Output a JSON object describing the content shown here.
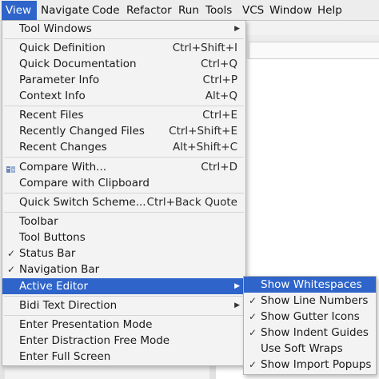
{
  "menubar": {
    "items": [
      {
        "label": "View",
        "active": true
      },
      {
        "label": "Navigate"
      },
      {
        "label": "Code"
      },
      {
        "label": "Refactor"
      },
      {
        "label": "Run"
      },
      {
        "label": "Tools"
      },
      {
        "label": "VCS"
      },
      {
        "label": "Window"
      },
      {
        "label": "Help"
      }
    ]
  },
  "view_menu": {
    "items": [
      {
        "label": "Tool Windows",
        "submenu": true
      },
      {
        "label": "Quick Definition",
        "shortcut": "Ctrl+Shift+I"
      },
      {
        "label": "Quick Documentation",
        "shortcut": "Ctrl+Q"
      },
      {
        "label": "Parameter Info",
        "shortcut": "Ctrl+P"
      },
      {
        "label": "Context Info",
        "shortcut": "Alt+Q"
      },
      {
        "label": "Recent Files",
        "shortcut": "Ctrl+E"
      },
      {
        "label": "Recently Changed Files",
        "shortcut": "Ctrl+Shift+E"
      },
      {
        "label": "Recent Changes",
        "shortcut": "Alt+Shift+C"
      },
      {
        "label": "Compare With...",
        "shortcut": "Ctrl+D",
        "icon": "compare-icon"
      },
      {
        "label": "Compare with Clipboard"
      },
      {
        "label": "Quick Switch Scheme...",
        "shortcut": "Ctrl+Back Quote"
      },
      {
        "label": "Toolbar"
      },
      {
        "label": "Tool Buttons"
      },
      {
        "label": "Status Bar",
        "checked": true
      },
      {
        "label": "Navigation Bar",
        "checked": true
      },
      {
        "label": "Active Editor",
        "submenu": true,
        "highlighted": true
      },
      {
        "label": "Bidi Text Direction",
        "submenu": true
      },
      {
        "label": "Enter Presentation Mode"
      },
      {
        "label": "Enter Distraction Free Mode"
      },
      {
        "label": "Enter Full Screen"
      }
    ]
  },
  "active_editor_submenu": {
    "items": [
      {
        "label": "Show Whitespaces",
        "highlighted": true
      },
      {
        "label": "Show Line Numbers",
        "checked": true
      },
      {
        "label": "Show Gutter Icons",
        "checked": true
      },
      {
        "label": "Show Indent Guides",
        "checked": true
      },
      {
        "label": "Use Soft Wraps"
      },
      {
        "label": "Show Import Popups",
        "checked": true
      }
    ]
  },
  "glyphs": {
    "check": "✓",
    "submenu_arrow": "▶"
  },
  "colors": {
    "highlight": "#2f65ca",
    "menu_bg": "#f3f3f3"
  }
}
